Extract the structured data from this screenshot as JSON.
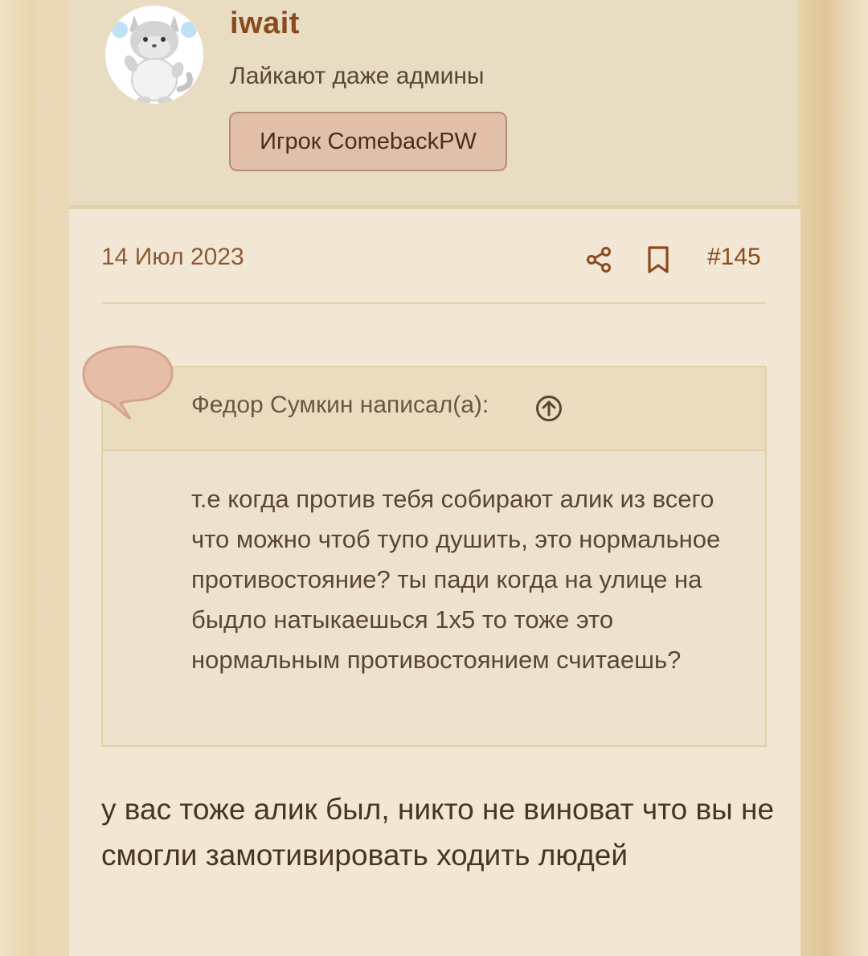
{
  "user": {
    "name": "iwait",
    "title": "Лайкают даже админы",
    "badge": "Игрок ComebackPW"
  },
  "post": {
    "date": "14 Июл 2023",
    "number": "#145",
    "quote": {
      "author": "Федор Сумкин написал(а):",
      "text": "т.е когда против тебя собирают алик из всего что можно чтоб тупо душить, это нормальное противостояние? ты пади когда на улице на быдло натыкаешься 1х5 то тоже это нормальным противостоянием считаешь?"
    },
    "body": "у вас тоже алик был, никто не виноват что вы не смогли замотивировать ходить людей"
  },
  "icons": {
    "share": "share-icon",
    "bookmark": "bookmark-icon",
    "quote_jump": "arrow-up-circle-icon",
    "quote_marker": "speech-bubble-icon",
    "avatar": "cat-avatar-icon"
  },
  "colors": {
    "accent": "#8b4a1e",
    "badge_bg": "#e2bfa8",
    "post_bg": "#f2e7d5",
    "quote_bubble": "#e6bea8"
  }
}
